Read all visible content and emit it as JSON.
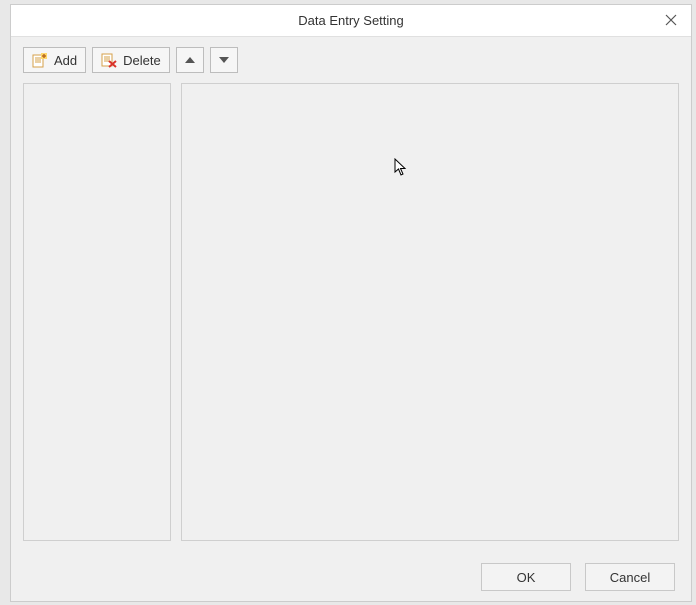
{
  "dialog": {
    "title": "Data Entry Setting"
  },
  "toolbar": {
    "add_label": "Add",
    "delete_label": "Delete"
  },
  "footer": {
    "ok_label": "OK",
    "cancel_label": "Cancel"
  }
}
